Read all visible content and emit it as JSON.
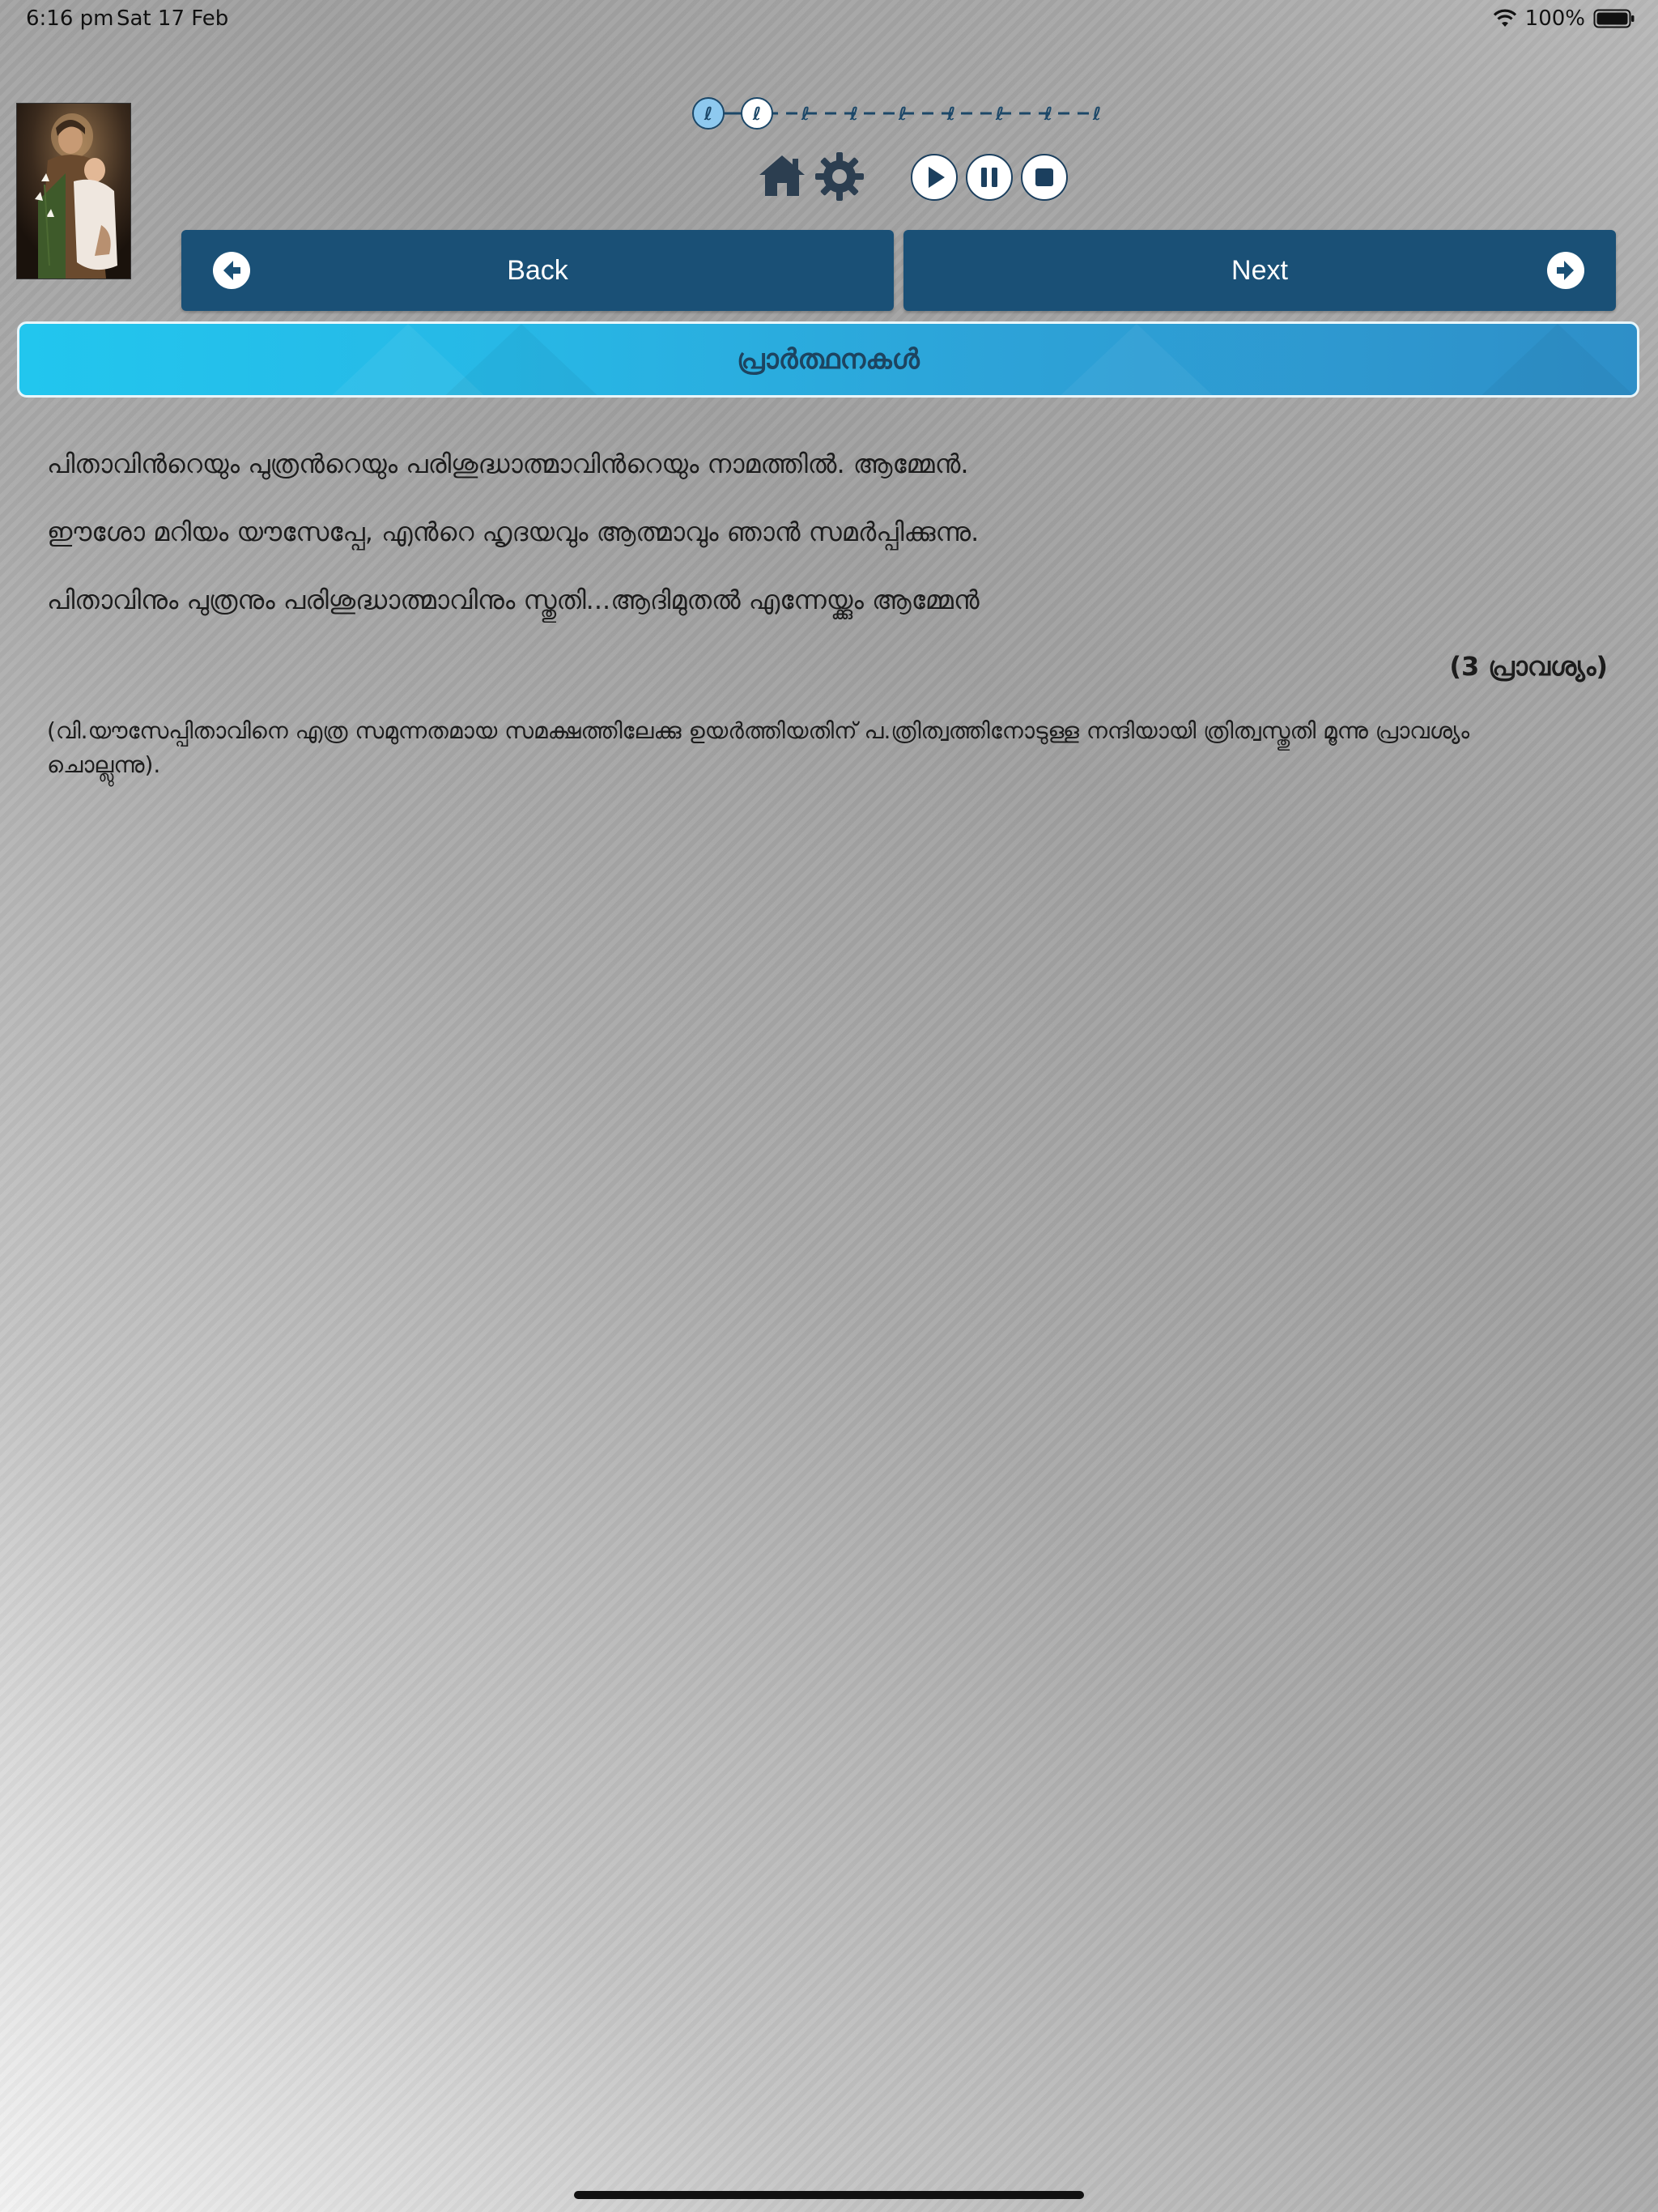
{
  "status_bar": {
    "time": "6:16 pm",
    "date": "Sat 17 Feb",
    "battery": "100%"
  },
  "progress": {
    "total_steps": 9,
    "current_step": 1,
    "icon": "kneeling-prayer-icon"
  },
  "toolbar": {
    "home_icon": "home-icon",
    "settings_icon": "gear-icon",
    "play_icon": "play-icon",
    "pause_icon": "pause-icon",
    "stop_icon": "stop-icon"
  },
  "nav": {
    "back_label": "Back",
    "next_label": "Next"
  },
  "header": {
    "title": "പ്രാർത്ഥനകൾ"
  },
  "content": {
    "lines": [
      "പിതാവിൻറെയും പുത്രൻറെയും പരിശുദ്ധാത്മാവിൻറെയും നാമത്തിൽ. ആമ്മേൻ.",
      "ഈശോ മറിയം യൗസേപ്പേ,  എൻറെ ഹൃദയവും ആത്മാവും ഞാൻ സമർപ്പിക്കുന്നു.",
      "പിതാവിനും പുത്രനും പരിശുദ്ധാത്മാവിനും സ്തുതി...ആദിമുതൽ എന്നേയ്ക്കും ആമ്മേൻ"
    ],
    "repeat_note": "(3 പ്രാവശ്യം)",
    "footnote": "(വി.യൗസേപ്പിതാവിനെ എത്ര സമുന്നതമായ സമക്ഷത്തിലേക്കു ഉയർത്തിയതിന് പ.ത്രിത്വത്തിനോടുള്ള നന്ദിയായി ത്രിത്വസ്തുതി മൂന്നു പ്രാവശ്യം ചൊല്ലുന്നു)."
  },
  "colors": {
    "nav_button": "#1a5076",
    "header_start": "#22c6ee",
    "header_end": "#2e8fc8",
    "icon_dark": "#1b3f5e"
  }
}
